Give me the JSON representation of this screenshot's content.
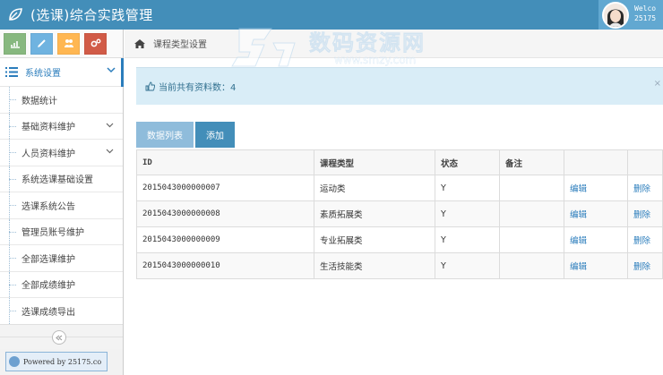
{
  "header": {
    "title": "(选课)综合实践管理",
    "welcome_line1": "Welco",
    "welcome_line2": "25175"
  },
  "shortcuts": [
    {
      "icon": "chart-icon",
      "color": "#87b87f"
    },
    {
      "icon": "pencil-icon",
      "color": "#6fb3e0"
    },
    {
      "icon": "users-icon",
      "color": "#ffb752"
    },
    {
      "icon": "cogs-icon",
      "color": "#d15b47"
    }
  ],
  "sidebar": {
    "section_label": "系统设置",
    "items": [
      {
        "label": "数据统计"
      },
      {
        "label": "基础资料维护"
      },
      {
        "label": "人员资料维护"
      },
      {
        "label": "系统选课基础设置"
      },
      {
        "label": "选课系统公告"
      },
      {
        "label": "管理员账号维护"
      },
      {
        "label": "全部选课维护"
      },
      {
        "label": "全部成绩维护"
      },
      {
        "label": "选课成绩导出"
      }
    ],
    "powered_by": "Powered by 25175.co"
  },
  "breadcrumb": {
    "page": "课程类型设置"
  },
  "info": {
    "text": "当前共有资料数：4"
  },
  "tabs": {
    "list_label": "数据列表",
    "add_label": "添加"
  },
  "table": {
    "headers": {
      "id": "ID",
      "type": "课程类型",
      "state": "状态",
      "note": "备注"
    },
    "rows": [
      {
        "id": "2015043000000007",
        "type": "运动类",
        "state": "Y",
        "note": "",
        "edit": "编辑",
        "delete": "删除"
      },
      {
        "id": "2015043000000008",
        "type": "素质拓展类",
        "state": "Y",
        "note": "",
        "edit": "编辑",
        "delete": "删除"
      },
      {
        "id": "2015043000000009",
        "type": "专业拓展类",
        "state": "Y",
        "note": "",
        "edit": "编辑",
        "delete": "删除"
      },
      {
        "id": "2015043000000010",
        "type": "生活技能类",
        "state": "Y",
        "note": "",
        "edit": "编辑",
        "delete": "删除"
      }
    ]
  },
  "watermark": {
    "text": "数码资源网",
    "url": "www.smzy.com"
  },
  "colors": {
    "header_blue": "#438eb9",
    "link_blue": "#2b7dbc",
    "info_bg": "#d9edf7"
  }
}
